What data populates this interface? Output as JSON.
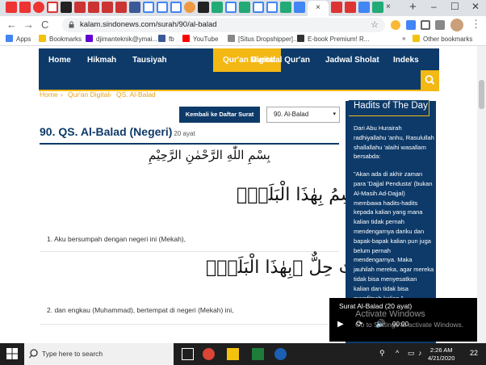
{
  "browser": {
    "url": "kalam.sindonews.com/surah/90/al-balad",
    "new_tab": "+",
    "tab_close": "×",
    "win_min": "–",
    "win_max": "☐",
    "win_close": "✕",
    "back": "←",
    "forward": "→",
    "reload": "C",
    "star": "☆",
    "menu": "⋮",
    "bookmarks": [
      {
        "label": "Apps",
        "icon": "apps-icon"
      },
      {
        "label": "Bookmarks",
        "icon": "star-icon"
      },
      {
        "label": "djimanteknik@ymai...",
        "icon": "yahoo-icon"
      },
      {
        "label": "fb",
        "icon": "facebook-icon"
      },
      {
        "label": "YouTube",
        "icon": "youtube-icon"
      },
      {
        "label": "[Situs Dropshipper]...",
        "icon": "globe-icon"
      },
      {
        "label": "E-book Premium! R...",
        "icon": "ebook-icon"
      },
      {
        "label": "»",
        "icon": ""
      },
      {
        "label": "Other bookmarks",
        "icon": "folder-icon"
      }
    ]
  },
  "nav": {
    "items": [
      "Home",
      "Hikmah",
      "Tausiyah",
      "Qur'an Digital",
      "Murottal Qur'an",
      "Jadwal Sholat",
      "Indeks"
    ],
    "active": "Qur'an Digital"
  },
  "breadcrumb": {
    "home": "Home",
    "sep": "›",
    "section": "Qur'an Digital",
    "page": "QS. Al-Balad"
  },
  "controls": {
    "back_label": "Kembali ke Daftar Surat",
    "select_value": "90. Al-Balad",
    "select_arrow": "▾"
  },
  "surah": {
    "title": "90. QS. Al-Balad (Negeri)",
    "count": "20 ayat",
    "basmala": "بِسْمِ اللّٰهِ الرَّحْمٰنِ الرَّحِيْمِ",
    "ayat": [
      {
        "arabic": "لَآ اُقْسِمُ بِهٰذَا الْبَلَدِۙ",
        "text": "1. Aku bersumpah dengan negeri ini (Mekah),"
      },
      {
        "arabic": "وَاَنْتَ حِلٌّ ۢبِهٰذَا الْبَلَدِۙ",
        "text": "2. dan engkau (Muhammad), bertempat di negeri (Mekah) ini,"
      }
    ]
  },
  "hadith": {
    "heading": "Hadits of The Day",
    "intro": "Dari Abu Hurairah radhiyallahu 'anhu, Rasulullah shallallahu 'alaihi wasallam bersabda:",
    "quote": "\"Akan ada di akhir zaman para 'Dajjal Pendusta' (bukan Al-Masih Ad-Dajjal) membawa hadits-hadits kepada kalian yang mana kalian tidak pernah mendengarnya dariku dan bapak-bapak kalian pun juga belum pernah mendengarnya. Maka jauhilah mereka, agar mereka tidak bisa menyesatkan kalian dan tidak bisa memfitnah kalian.\""
  },
  "player": {
    "title": "Surat Al-Balad (20 ayat)",
    "play": "▶",
    "repeat": "⟳",
    "volume": "🔊",
    "time": "00:00"
  },
  "watermark": {
    "line1": "Activate Windows",
    "line2": "Go to Settings to activate Windows."
  },
  "taskbar": {
    "search_placeholder": "Type here to search",
    "time": "2:26 AM",
    "date": "4/21/2020",
    "notif_count": "22"
  },
  "colors": {
    "navy": "#0d3a69",
    "gold": "#f3b814",
    "link": "#e4a11b"
  }
}
